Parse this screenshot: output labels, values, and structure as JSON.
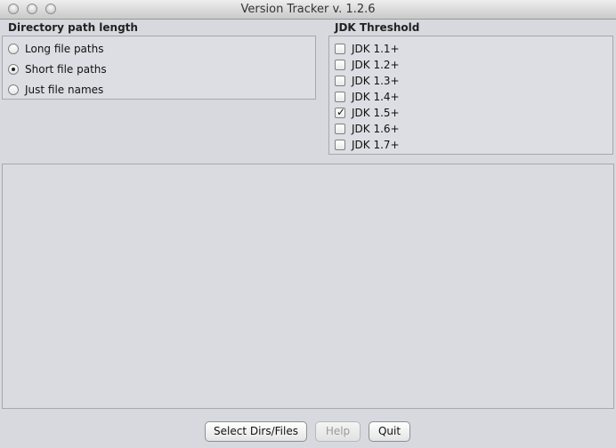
{
  "window": {
    "title": "Version Tracker v. 1.2.6"
  },
  "directory_section": {
    "title": "Directory path length",
    "options": [
      {
        "label": "Long file paths",
        "selected": false
      },
      {
        "label": "Short file paths",
        "selected": true
      },
      {
        "label": "Just file names",
        "selected": false
      }
    ]
  },
  "jdk_section": {
    "title": "JDK Threshold",
    "options": [
      {
        "label": "JDK 1.1+",
        "checked": false
      },
      {
        "label": "JDK 1.2+",
        "checked": false
      },
      {
        "label": "JDK 1.3+",
        "checked": false
      },
      {
        "label": "JDK 1.4+",
        "checked": false
      },
      {
        "label": "JDK 1.5+",
        "checked": true
      },
      {
        "label": "JDK 1.6+",
        "checked": false
      },
      {
        "label": "JDK 1.7+",
        "checked": false
      }
    ]
  },
  "buttons": {
    "select": "Select Dirs/Files",
    "help": "Help",
    "quit": "Quit"
  }
}
